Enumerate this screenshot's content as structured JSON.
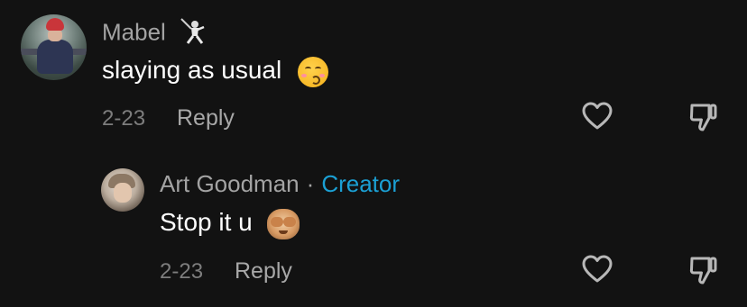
{
  "comments": [
    {
      "author": "Mabel",
      "author_icon": "fencer-emoji-icon",
      "text": "slaying as usual",
      "emoji": "kissing-face-closed-eyes-emoji",
      "date": "2-23",
      "reply_label": "Reply"
    },
    {
      "author": "Art Goodman",
      "separator": "·",
      "badge": "Creator",
      "badge_color": "#1ba0d4",
      "text": "Stop it u",
      "emoji": "see-no-evil-monkey-emoji",
      "date": "2-23",
      "reply_label": "Reply"
    }
  ],
  "colors": {
    "background": "#121212",
    "username": "#a3a3a3",
    "body": "#ffffff",
    "meta": "#7d7d7d"
  },
  "icons": {
    "like": "heart-outline-icon",
    "dislike": "thumbs-down-outline-icon"
  }
}
